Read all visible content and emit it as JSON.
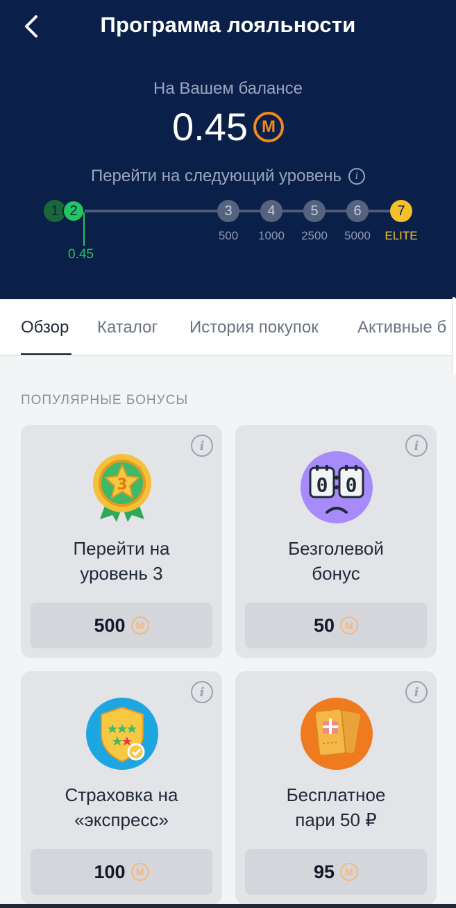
{
  "header": {
    "title": "Программа лояльности",
    "balance_label": "На Вашем балансе",
    "balance_value": "0.45",
    "currency_symbol": "M",
    "next_level_label": "Перейти на следующий уровень",
    "info_glyph": "i"
  },
  "levels": [
    {
      "number": "1",
      "value": ""
    },
    {
      "number": "2",
      "value": ""
    },
    {
      "number": "3",
      "value": "500"
    },
    {
      "number": "4",
      "value": "1000"
    },
    {
      "number": "5",
      "value": "2500"
    },
    {
      "number": "6",
      "value": "5000"
    },
    {
      "number": "7",
      "value": "ELITE"
    }
  ],
  "current_progress": "0.45",
  "tabs": [
    {
      "label": "Обзор"
    },
    {
      "label": "Каталог"
    },
    {
      "label": "История покупок"
    },
    {
      "label": "Активные б"
    }
  ],
  "section_title": "ПОПУЛЯРНЫЕ БОНУСЫ",
  "bonuses": [
    {
      "line1": "Перейти на",
      "line2": "уровень 3",
      "price": "500",
      "icon": "level-3-medal-icon"
    },
    {
      "line1": "Безголевой",
      "line2": "бонус",
      "price": "50",
      "icon": "scoreboard-icon"
    },
    {
      "line1": "Страховка на",
      "line2": "«экспресс»",
      "price": "100",
      "icon": "shield-icon"
    },
    {
      "line1": "Бесплатное",
      "line2": "пари 50 ₽",
      "price": "95",
      "icon": "gift-ticket-icon"
    }
  ],
  "colors": {
    "header_bg": "#0b2049",
    "accent_green": "#22c55e",
    "elite_yellow": "#f5c12a",
    "coin_orange": "#f08a1c"
  }
}
